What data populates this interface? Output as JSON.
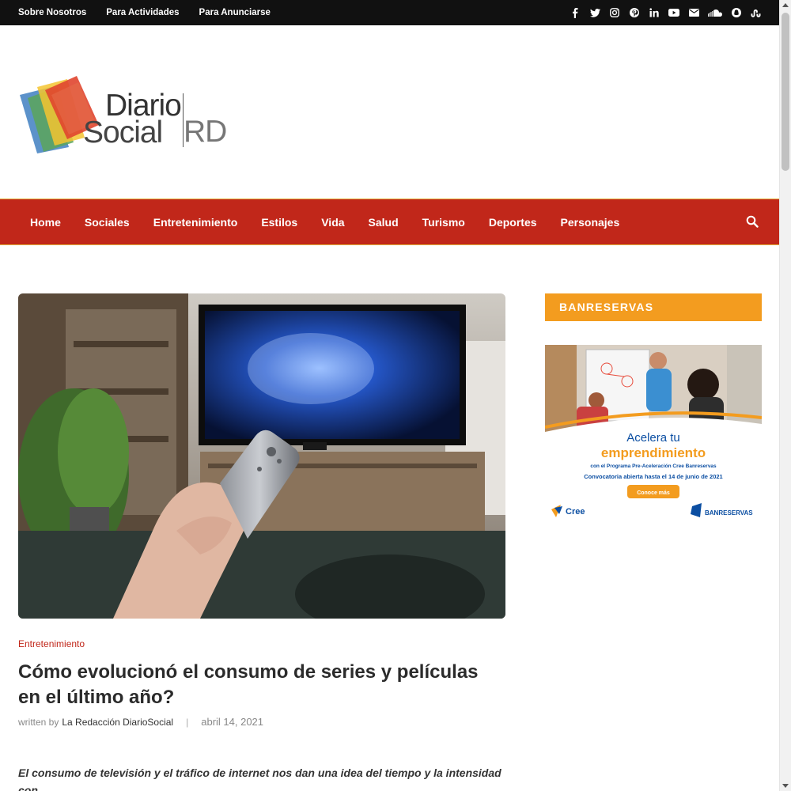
{
  "topbar": {
    "links": [
      "Sobre Nosotros",
      "Para Actividades",
      "Para Anunciarse"
    ],
    "social_icons": [
      "facebook-icon",
      "twitter-icon",
      "instagram-icon",
      "pinterest-icon",
      "linkedin-icon",
      "youtube-icon",
      "email-icon",
      "soundcloud-icon",
      "snapchat-icon",
      "stumbleupon-icon"
    ]
  },
  "logo": {
    "line1": "Diario",
    "line2": "Social",
    "suffix": "RD"
  },
  "nav": {
    "items": [
      "Home",
      "Sociales",
      "Entretenimiento",
      "Estilos",
      "Vida",
      "Salud",
      "Turismo",
      "Deportes",
      "Personajes"
    ]
  },
  "article": {
    "category": "Entretenimiento",
    "title": "Cómo evolucionó el consumo de series y películas en el último año?",
    "written_by": "written by",
    "author": "La Redacción DiarioSocial",
    "separator": "|",
    "date": "abril 14, 2021",
    "excerpt": "El consumo de televisión y el tráfico de internet nos dan una idea del tiempo y la intensidad con"
  },
  "sidebar": {
    "widget_title": "BANRESERVAS",
    "ad": {
      "headline1": "Acelera tu",
      "headline2": "emprendimiento",
      "sub": "con el Programa Pre-Aceleración Cree Banreservas",
      "deadline": "Convocatoria abierta hasta el 14 de junio de 2021",
      "cta": "Conoce más",
      "brand_left": "Cree",
      "brand_right": "BANRESERVAS"
    }
  },
  "colors": {
    "topbar": "#111111",
    "nav": "#c1271a",
    "accent": "#f39c1f",
    "category": "#c1271a"
  }
}
